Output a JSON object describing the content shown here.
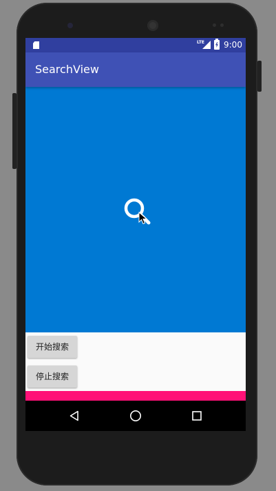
{
  "status_bar": {
    "network_label": "LTE",
    "time": "9:00",
    "icons": [
      "sd-card-icon",
      "signal-icon",
      "battery-charging-icon"
    ]
  },
  "app_bar": {
    "title": "SearchView",
    "color": "#3f51b5"
  },
  "search_view": {
    "icon": "search-icon",
    "background": "#0079d3"
  },
  "buttons": {
    "start_label": "开始搜索",
    "stop_label": "停止搜索"
  },
  "accent_color": "#ff1177",
  "nav_bar": {
    "icons": [
      "back-icon",
      "home-icon",
      "recents-icon"
    ]
  }
}
